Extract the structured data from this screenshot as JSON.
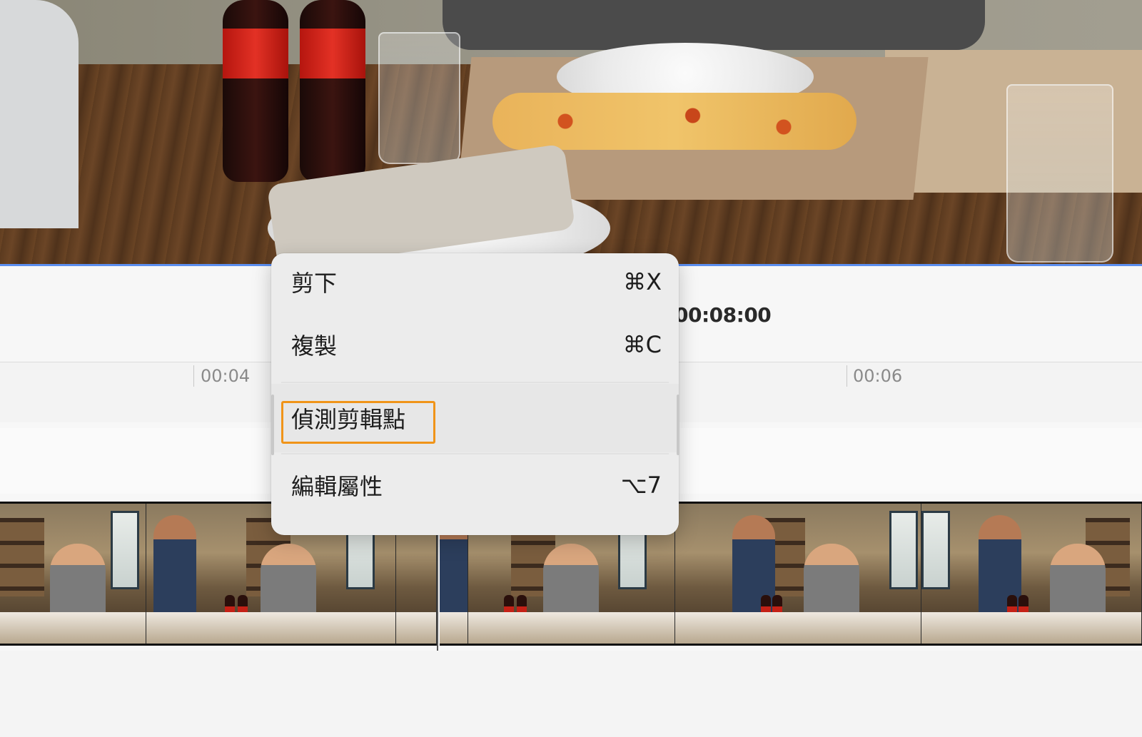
{
  "timeline": {
    "current_timecode": "00:08:00",
    "ruler_ticks": [
      "00:04",
      "00:06"
    ]
  },
  "context_menu": {
    "items": [
      {
        "label": "剪下",
        "shortcut": "⌘X"
      },
      {
        "label": "複製",
        "shortcut": "⌘C"
      },
      {
        "label": "偵測剪輯點",
        "shortcut": ""
      },
      {
        "label": "編輯屬性",
        "shortcut": "⌥7"
      }
    ],
    "highlighted_index": 2
  },
  "colors": {
    "accent_timeline": "#5b8ef0",
    "highlight_border": "#f09419"
  }
}
